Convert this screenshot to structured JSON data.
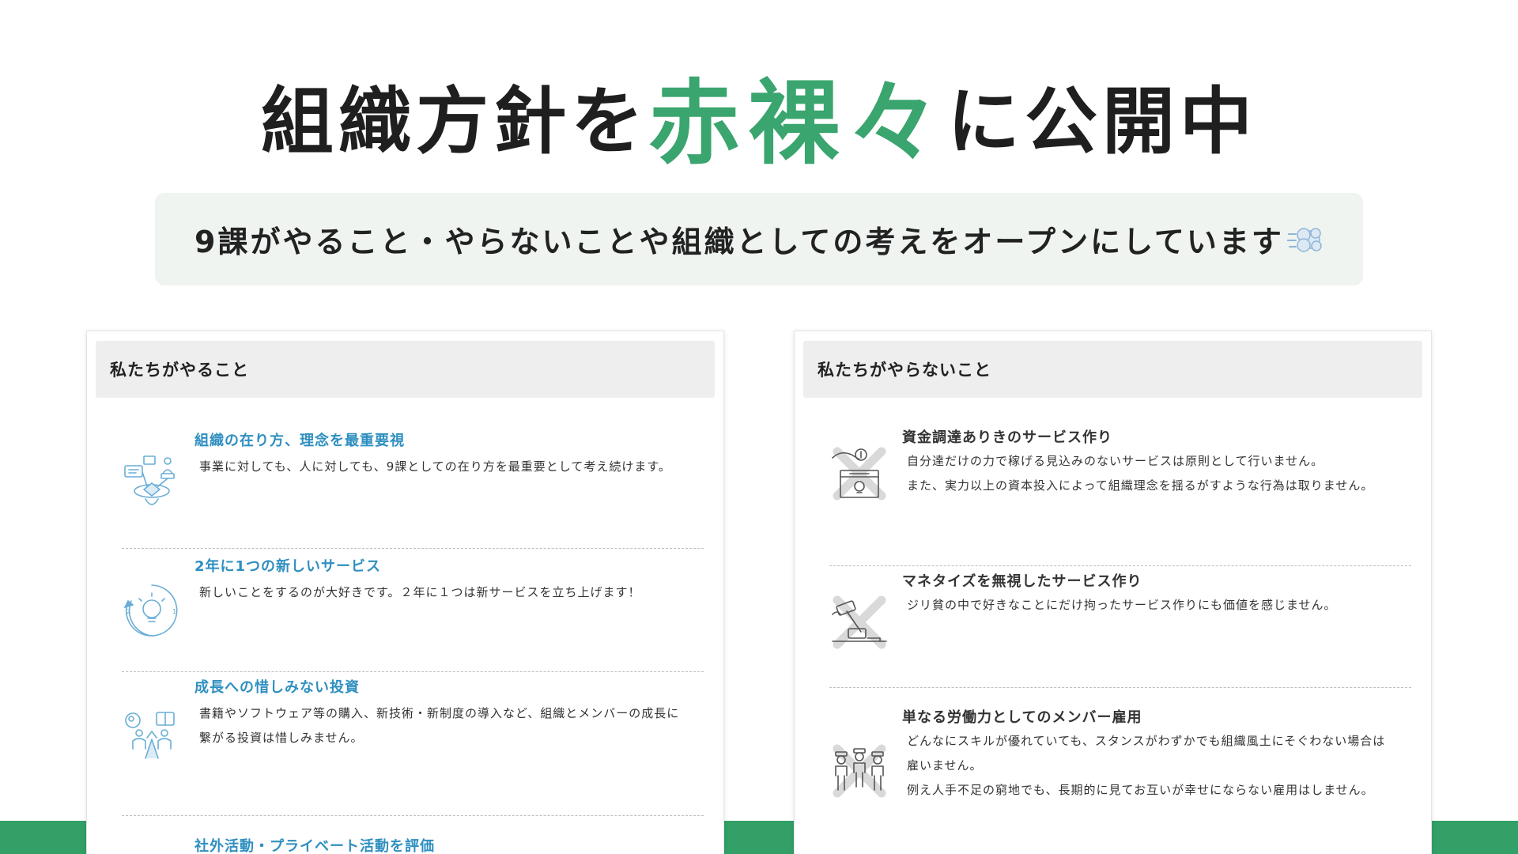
{
  "hero": {
    "prefix": "組織方針を",
    "accent": "赤裸々",
    "suffix": "に公開中"
  },
  "subtitle": {
    "text": "9課がやること・やらないことや組織としての考えをオープンにしています",
    "icon": "dash-puff-icon"
  },
  "colors": {
    "accent_green": "#3aa56e",
    "band_green": "#33a067",
    "item_title_blue": "#2f8fc0"
  },
  "do_card": {
    "header": "私たちがやること",
    "items": [
      {
        "title": "組織の在り方、理念を最重要視",
        "lines": [
          "事業に対しても、人に対しても、9課としての在り方を最重要として考え続けます。"
        ],
        "icon": "organization-network-icon"
      },
      {
        "title": "2年に1つの新しいサービス",
        "lines": [
          "新しいことをするのが大好きです。２年に１つは新サービスを立ち上げます！"
        ],
        "icon": "lightbulb-cycle-icon"
      },
      {
        "title": "成長への惜しみない投資",
        "lines": [
          "書籍やソフトウェア等の購入、新技術・新制度の導入など、組織とメンバーの成長に",
          "繋がる投資は惜しみません。"
        ],
        "icon": "growth-investment-icon"
      },
      {
        "title": "社外活動・プライベート活動を評価",
        "lines": [],
        "icon": ""
      }
    ]
  },
  "dont_card": {
    "header": "私たちがやらないこと",
    "items": [
      {
        "title": "資金調達ありきのサービス作り",
        "lines": [
          "自分達だけの力で稼げる見込みのないサービスは原則として行いません。",
          "また、実力以上の資本投入によって組織理念を揺るがすような行為は取りません。"
        ],
        "icon": "funding-box-crossed-icon"
      },
      {
        "title": "マネタイズを無視したサービス作り",
        "lines": [
          "ジリ貧の中で好きなことにだけ拘ったサービス作りにも価値を感じません。"
        ],
        "icon": "hammer-crossed-icon"
      },
      {
        "title": "単なる労働力としてのメンバー雇用",
        "lines": [
          "どんなにスキルが優れていても、スタンスがわずかでも組織風土にそぐわない場合は",
          "雇いません。",
          "例え人手不足の窮地でも、長期的に見てお互いが幸せにならない雇用はしません。"
        ],
        "icon": "workers-crossed-icon"
      }
    ]
  }
}
